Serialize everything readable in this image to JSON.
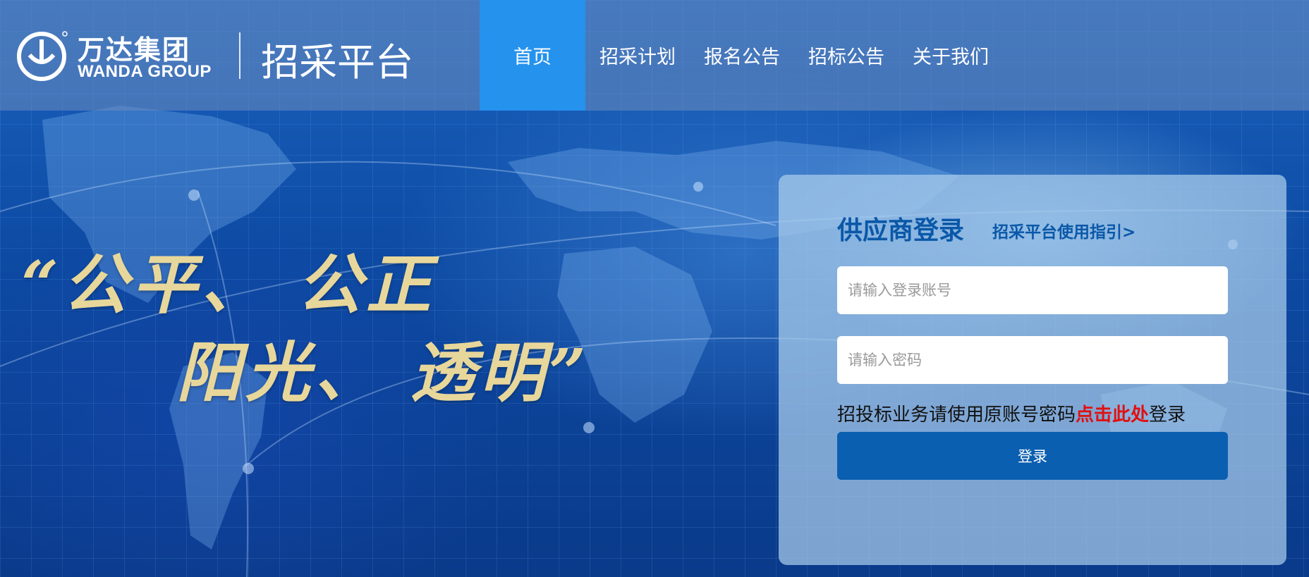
{
  "brand": {
    "name_cn": "万达集团",
    "name_en": "WANDA GROUP",
    "platform": "招采平台"
  },
  "nav": {
    "items": [
      {
        "label": "首页",
        "active": true
      },
      {
        "label": "招采计划",
        "active": false
      },
      {
        "label": "报名公告",
        "active": false
      },
      {
        "label": "招标公告",
        "active": false
      },
      {
        "label": "关于我们",
        "active": false
      }
    ]
  },
  "slogan": {
    "line1": "“公平、 公正",
    "line2": "阳光、 透明”"
  },
  "login": {
    "title": "供应商登录",
    "guide_link": "招采平台使用指引>",
    "username_placeholder": "请输入登录账号",
    "password_placeholder": "请输入密码",
    "notice_before": "招投标业务请使用原账号密码",
    "notice_link": "点击此处",
    "notice_after": "登录",
    "button_label": "登录"
  },
  "colors": {
    "nav_active": "#2592ee",
    "primary_button": "#0a5fb0",
    "title_blue": "#0a58a8",
    "notice_red": "#e01010",
    "slogan_gold": "#e8d79b"
  }
}
